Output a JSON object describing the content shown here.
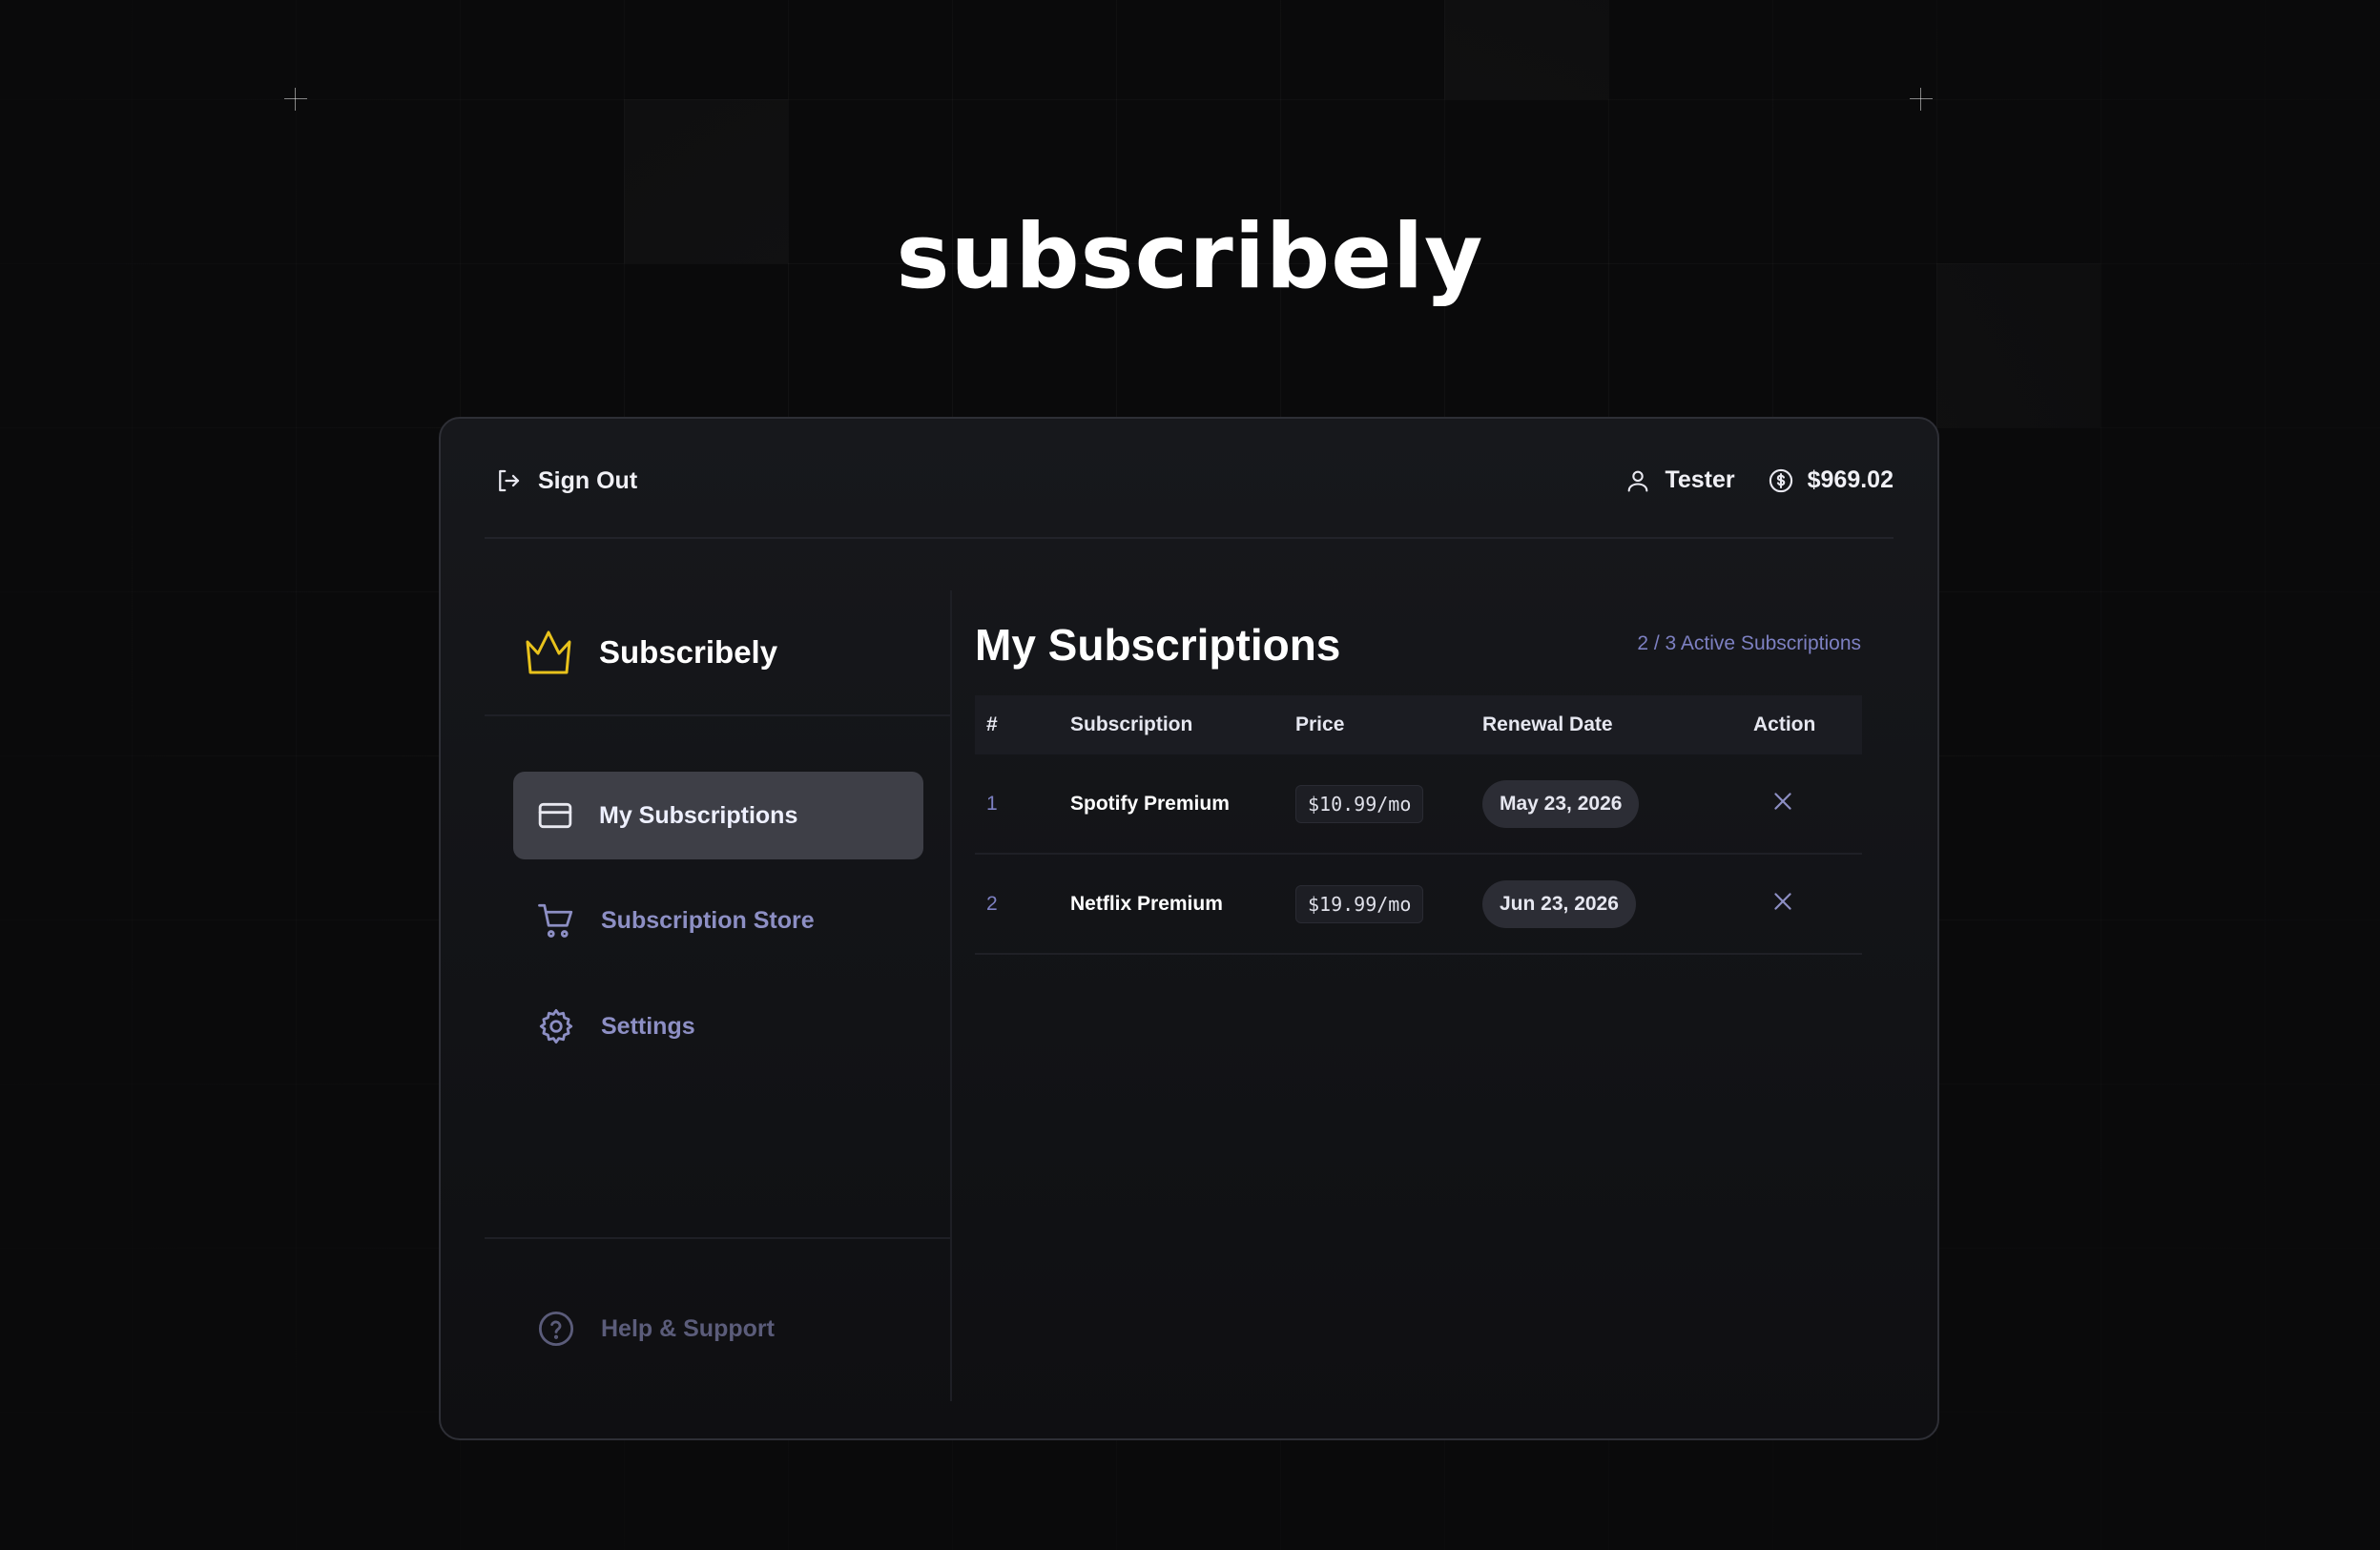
{
  "brand": {
    "title": "subscribely"
  },
  "topbar": {
    "sign_out_label": "Sign Out",
    "username": "Tester",
    "balance": "$969.02"
  },
  "sidebar": {
    "logo_text": "Subscribely",
    "items": [
      {
        "label": "My Subscriptions",
        "icon": "credit-card-icon",
        "active": true
      },
      {
        "label": "Subscription Store",
        "icon": "cart-icon",
        "active": false
      },
      {
        "label": "Settings",
        "icon": "gear-icon",
        "active": false
      }
    ],
    "help_label": "Help & Support"
  },
  "main": {
    "title": "My Subscriptions",
    "active_count": "2 / 3 Active Subscriptions",
    "table": {
      "headers": [
        "#",
        "Subscription",
        "Price",
        "Renewal Date",
        "Action"
      ],
      "rows": [
        {
          "index": "1",
          "name": "Spotify Premium",
          "price": "$10.99/mo",
          "renewal": "May 23, 2026"
        },
        {
          "index": "2",
          "name": "Netflix Premium",
          "price": "$19.99/mo",
          "renewal": "Jun 23, 2026"
        }
      ]
    }
  },
  "colors": {
    "accent_crown": "#e8c21c",
    "muted_text": "#7d80c2",
    "active_nav_bg": "#3e3f47"
  }
}
